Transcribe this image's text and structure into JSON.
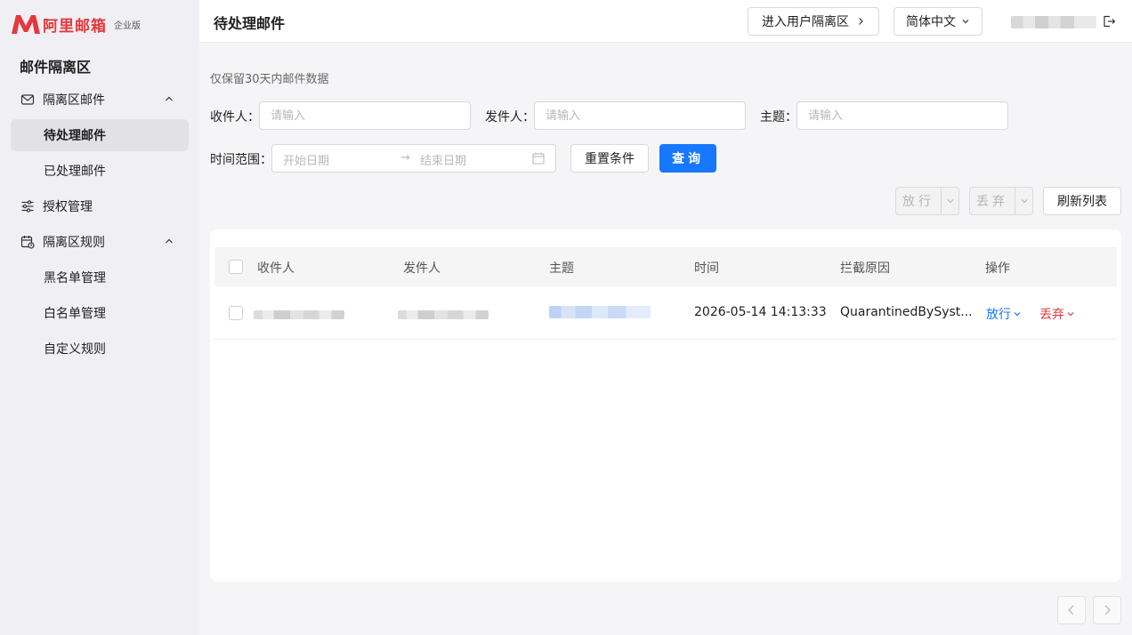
{
  "brand": {
    "name": "阿里邮箱",
    "badge": "企业版",
    "color": "#e5383b"
  },
  "sidebar": {
    "title": "邮件隔离区",
    "items": [
      {
        "label": "隔离区邮件",
        "icon": "mail-icon"
      },
      {
        "label": "待处理邮件"
      },
      {
        "label": "已处理邮件"
      },
      {
        "label": "授权管理",
        "icon": "sliders-icon"
      },
      {
        "label": "隔离区规则",
        "icon": "calendar-clock-icon"
      },
      {
        "label": "黑名单管理"
      },
      {
        "label": "白名单管理"
      },
      {
        "label": "自定义规则"
      }
    ]
  },
  "header": {
    "title": "待处理邮件",
    "enter_user_label": "进入用户隔离区",
    "language": "简体中文"
  },
  "filters": {
    "retention_note": "仅保留30天内邮件数据",
    "recipient_label": "收件人：",
    "recipient_placeholder": "请输入",
    "sender_label": "发件人：",
    "sender_placeholder": "请输入",
    "subject_label": "主题：",
    "subject_placeholder": "请输入",
    "time_range_label": "时间范围：",
    "start_placeholder": "开始日期",
    "end_placeholder": "结束日期",
    "reset_label": "重置条件",
    "query_label": "查询"
  },
  "toolbar": {
    "release_label": "放行",
    "discard_label": "丢弃",
    "refresh_label": "刷新列表"
  },
  "table": {
    "columns": [
      "收件人",
      "发件人",
      "主题",
      "时间",
      "拦截原因",
      "操作"
    ],
    "rows": [
      {
        "time": "2026-05-14 14:13:33",
        "reason": "QuarantinedBySyst...",
        "release": "放行",
        "discard": "丢弃"
      }
    ]
  },
  "colors": {
    "primary": "#1677ff",
    "danger": "#e5383b"
  }
}
